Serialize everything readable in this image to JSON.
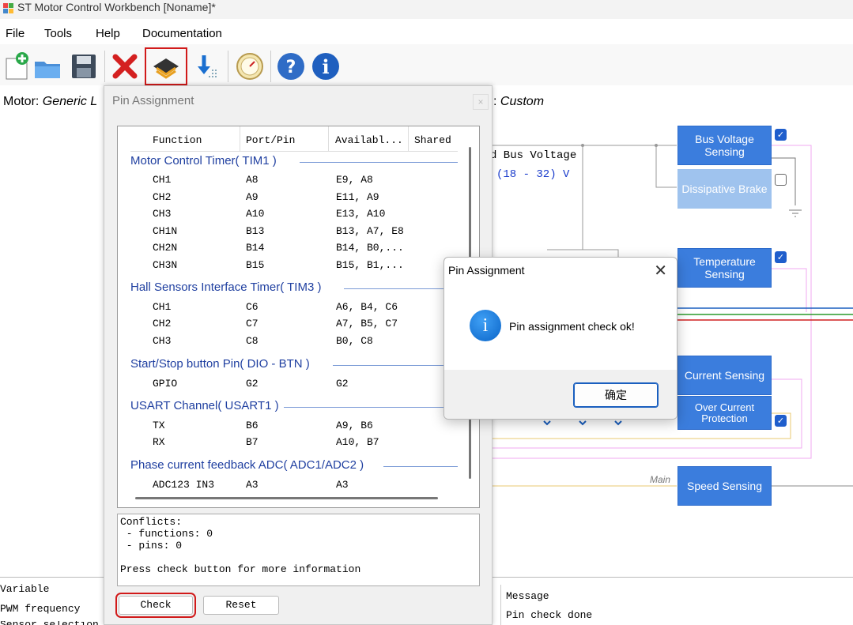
{
  "app": {
    "title": "ST Motor Control Workbench [Noname]*"
  },
  "menu": [
    "File",
    "Tools",
    "Help",
    "Documentation"
  ],
  "toolbar": {
    "icons": [
      "new-project-icon",
      "open-folder-icon",
      "save-icon",
      "close-project-icon",
      "chip-icon",
      "download-icon",
      "gauge-icon",
      "help-icon",
      "info-icon"
    ]
  },
  "motor": {
    "label": "Motor:",
    "value": "Generic L"
  },
  "control": {
    "suffix": ":",
    "value": "Custom"
  },
  "diagram": {
    "bus_voltage_text": "d Bus Voltage",
    "bus_range": "(18 - 32) V",
    "main_label": "Main",
    "blocks": {
      "bus_voltage": "Bus Voltage Sensing",
      "dissipative": "Dissipative Brake",
      "temperature": "Temperature Sensing",
      "current": "Current Sensing",
      "overcurrent": "Over Current Protection",
      "speed": "Speed Sensing"
    },
    "checks": {
      "bus_voltage": true,
      "dissipative": false,
      "temperature": true,
      "overcurrent": true
    }
  },
  "pin_window": {
    "title": "Pin Assignment",
    "close": "×",
    "headers": {
      "function": "Function",
      "port": "Port/Pin",
      "available": "Availabl...",
      "shared": "Shared"
    },
    "groups": [
      {
        "title": "Motor Control Timer( TIM1 )",
        "rows": [
          {
            "f": "CH1",
            "p": "A8",
            "a": "E9, A8"
          },
          {
            "f": "CH2",
            "p": "A9",
            "a": "E11, A9"
          },
          {
            "f": "CH3",
            "p": "A10",
            "a": "E13, A10"
          },
          {
            "f": "CH1N",
            "p": "B13",
            "a": "B13, A7, E8"
          },
          {
            "f": "CH2N",
            "p": "B14",
            "a": "B14, B0,..."
          },
          {
            "f": "CH3N",
            "p": "B15",
            "a": "B15, B1,..."
          }
        ]
      },
      {
        "title": "Hall Sensors Interface Timer( TIM3 )",
        "rows": [
          {
            "f": "CH1",
            "p": "C6",
            "a": "A6, B4, C6"
          },
          {
            "f": "CH2",
            "p": "C7",
            "a": "A7, B5, C7"
          },
          {
            "f": "CH3",
            "p": "C8",
            "a": "B0, C8"
          }
        ]
      },
      {
        "title": "Start/Stop button Pin( DIO - BTN )",
        "rows": [
          {
            "f": "GPIO",
            "p": "G2",
            "a": "G2"
          }
        ]
      },
      {
        "title": "USART Channel( USART1 )",
        "rows": [
          {
            "f": "TX",
            "p": "B6",
            "a": "A9, B6"
          },
          {
            "f": "RX",
            "p": "B7",
            "a": "A10, B7"
          }
        ]
      },
      {
        "title": "Phase current feedback ADC( ADC1/ADC2 )",
        "rows": [
          {
            "f": "ADC123_IN3",
            "p": "A3",
            "a": "A3"
          }
        ]
      }
    ],
    "conflicts": "Conflicts:\n - functions: 0\n - pins: 0\n\nPress check button for more information",
    "check_button": "Check",
    "reset_button": "Reset"
  },
  "message_box": {
    "title": "Pin Assignment",
    "icon": "i",
    "text": "Pin assignment check ok!",
    "ok_button": "确定"
  },
  "bottom": {
    "variable_header": "Variable",
    "pwm": "PWM frequency",
    "cut_row": "Sensor selection used",
    "message_header": "Message",
    "message_value": "Pin check done"
  },
  "colors": {
    "accent_block": "#3b7ddd",
    "highlight_red": "#d11a1a",
    "group_title": "#1f3fa0"
  }
}
